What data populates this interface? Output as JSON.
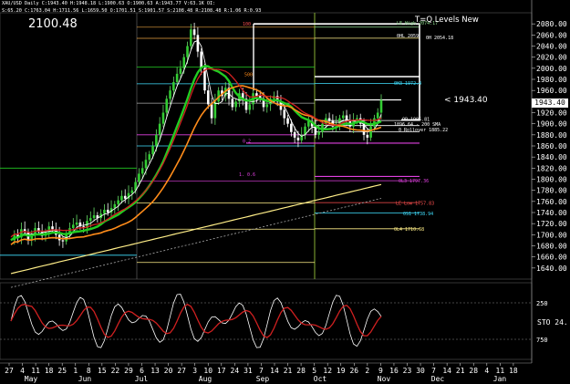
{
  "header": {
    "line1": "XAU/USD  Daily  C:1943.40  H:1948.18  L:1900.63  O:1900.63  A:1943.77  V:63.1K  OI:",
    "line2": "S:65.20  C:1763.04  H:1711.56  L:1659.50  O:1701.51  S:1901.57  S:2108.48  R:2108.48  R:1.06  R:0.93"
  },
  "overlay": {
    "big_price": "2100.48",
    "levels_title": "T=Q Levels New",
    "right_price_label": "< 1943.40",
    "price_box": "1943.40",
    "osc_label": "STO  24."
  },
  "colors": {
    "background": "#000000",
    "price_box": "#ffffff",
    "ema_green": "#22cc22",
    "ema_orange": "#ff8c1a",
    "sma_yellow": "#ffee88",
    "stoch_fast": "#ffffff",
    "stoch_slow": "#d02020",
    "magenta_level": "#e040e0",
    "cyan_level": "#40e0ff"
  },
  "annotations": [
    {
      "text": "LE High  2074.17",
      "color": "#8fdc8f"
    },
    {
      "text": "0HL 2059",
      "color": "#ffffff"
    },
    {
      "text": "0H  2054.18",
      "color": "#ffffff"
    },
    {
      "text": "0H3 1972.4",
      "color": "#40e0ff"
    },
    {
      "text": "OP 1905.81",
      "color": "#ffffff"
    },
    {
      "text": "1896.64 - 200 SMA",
      "color": "#ffffff"
    },
    {
      "text": "0 Rollover  1885.22",
      "color": "#ffffff"
    },
    {
      "text": "0L3 1797.36",
      "color": "#e040e0"
    },
    {
      "text": "LE Low 1757.83",
      "color": "#ff5050"
    },
    {
      "text": "0S1 1738.94",
      "color": "#40e0ff"
    },
    {
      "text": "0L4 1710.68",
      "color": "#ffee88"
    },
    {
      "text": "1. 0.6",
      "color": "#e040e0"
    },
    {
      "text": "100",
      "color": "#ff5050"
    },
    {
      "text": "500",
      "color": "#ff8c1a"
    },
    {
      "text": "0.2",
      "color": "#e040e0"
    }
  ],
  "chart_data": {
    "type": "candlestick",
    "title": "",
    "symbol": "XAU/USD",
    "timeframe": "Daily",
    "ylim": [
      1620,
      2100
    ],
    "y_ticks": [
      2080,
      2060,
      2040,
      2020,
      2000,
      1980,
      1960,
      1940,
      1920,
      1900,
      1880,
      1860,
      1840,
      1820,
      1800,
      1780,
      1760,
      1740,
      1720,
      1700,
      1680,
      1660,
      1640
    ],
    "x_ticks": [
      "27",
      "4",
      "11",
      "18",
      "25",
      "1",
      "8",
      "15",
      "22",
      "29",
      "6",
      "13",
      "20",
      "27",
      "3",
      "10",
      "17",
      "24",
      "31",
      "7",
      "14",
      "21",
      "28",
      "5",
      "12",
      "19",
      "26",
      "2",
      "9",
      "16",
      "23",
      "30",
      "7",
      "14",
      "21",
      "28",
      "4",
      "11",
      "18"
    ],
    "x_months": [
      "May",
      "Jun",
      "Jul",
      "Aug",
      "Sep",
      "Oct",
      "Nov",
      "Dec",
      "Jan"
    ],
    "last_close": 1943.4,
    "horizontal_levels": [
      {
        "name": "LE High",
        "value": 2074.17
      },
      {
        "name": "0H",
        "value": 2054.18
      },
      {
        "name": "0H3",
        "value": 1972.4
      },
      {
        "name": "OP",
        "value": 1905.81
      },
      {
        "name": "200 SMA",
        "value": 1896.64
      },
      {
        "name": "Rollover",
        "value": 1885.22
      },
      {
        "name": "0L3",
        "value": 1797.36
      },
      {
        "name": "LE Low",
        "value": 1757.83
      },
      {
        "name": "0S1",
        "value": 1738.94
      },
      {
        "name": "0L4",
        "value": 1710.68
      }
    ],
    "oscillator": {
      "name": "STO",
      "levels": [
        250,
        750
      ],
      "tick_labels": [
        "250",
        "750"
      ]
    }
  }
}
